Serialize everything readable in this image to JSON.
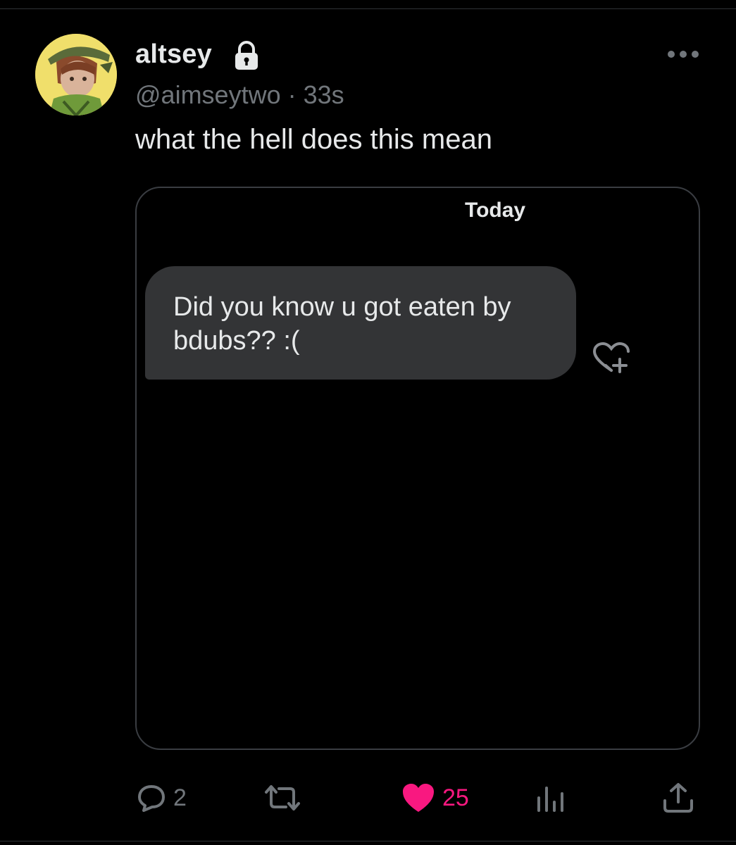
{
  "tweet": {
    "display_name": "altsey",
    "handle": "@aimseytwo",
    "separator": "·",
    "time": "33s",
    "text": "what the hell does this mean"
  },
  "media": {
    "date_header": "Today",
    "message_text": "Did you know u got eaten by bdubs?? :("
  },
  "actions": {
    "reply_count": "2",
    "like_count": "25"
  },
  "icons": {
    "lock": "lock-icon",
    "more": "more-icon",
    "reaction": "heart-plus-icon",
    "reply": "reply-icon",
    "retweet": "retweet-icon",
    "like": "heart-icon",
    "views": "views-icon",
    "share": "share-icon"
  },
  "colors": {
    "background": "#000000",
    "text": "#e7e9ea",
    "muted": "#71767b",
    "like": "#f91880",
    "bubble": "#333436"
  }
}
